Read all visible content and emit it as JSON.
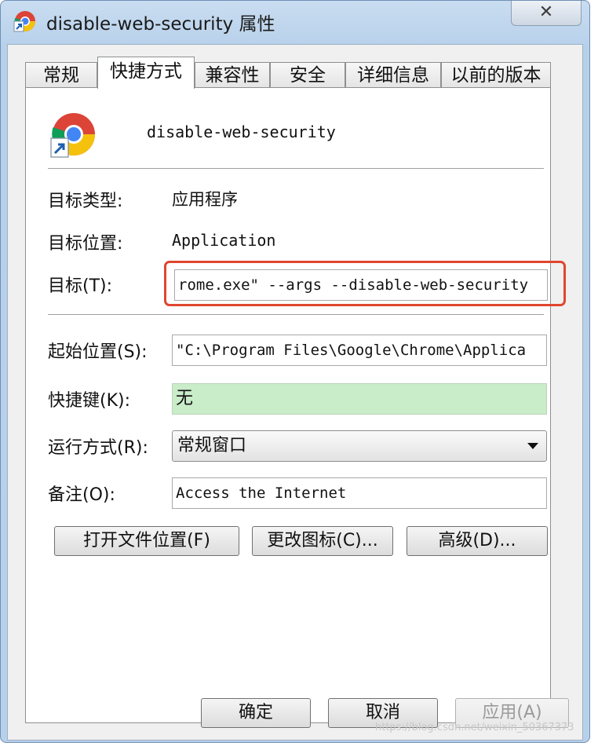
{
  "window": {
    "title": "disable-web-security 属性",
    "close_glyph": "✕"
  },
  "tabs": [
    {
      "label": "常规",
      "active": false
    },
    {
      "label": "快捷方式",
      "active": true
    },
    {
      "label": "兼容性",
      "active": false
    },
    {
      "label": "安全",
      "active": false
    },
    {
      "label": "详细信息",
      "active": false
    },
    {
      "label": "以前的版本",
      "active": false
    }
  ],
  "shortcut": {
    "name": "disable-web-security",
    "icon": "chrome-shortcut-icon",
    "target_type_label": "目标类型:",
    "target_type_value": "应用程序",
    "target_location_label": "目标位置:",
    "target_location_value": "Application",
    "target_label": "目标(T):",
    "target_value": "rome.exe\" --args --disable-web-security",
    "start_in_label": "起始位置(S):",
    "start_in_value": "\"C:\\Program Files\\Google\\Chrome\\Applica",
    "hotkey_label": "快捷键(K):",
    "hotkey_value": "无",
    "run_label": "运行方式(R):",
    "run_value": "常规窗口",
    "comment_label": "备注(O):",
    "comment_value": "Access the Internet"
  },
  "buttons": {
    "open_location": "打开文件位置(F)",
    "change_icon": "更改图标(C)...",
    "advanced": "高级(D)...",
    "ok": "确定",
    "cancel": "取消",
    "apply": "应用(A)"
  },
  "watermark": "https://blog.csdn.net/weixin_50367373",
  "colors": {
    "highlight": "#e0462f",
    "hotkey_field": "#c9ecc9",
    "frame": "#b8d1ea"
  }
}
